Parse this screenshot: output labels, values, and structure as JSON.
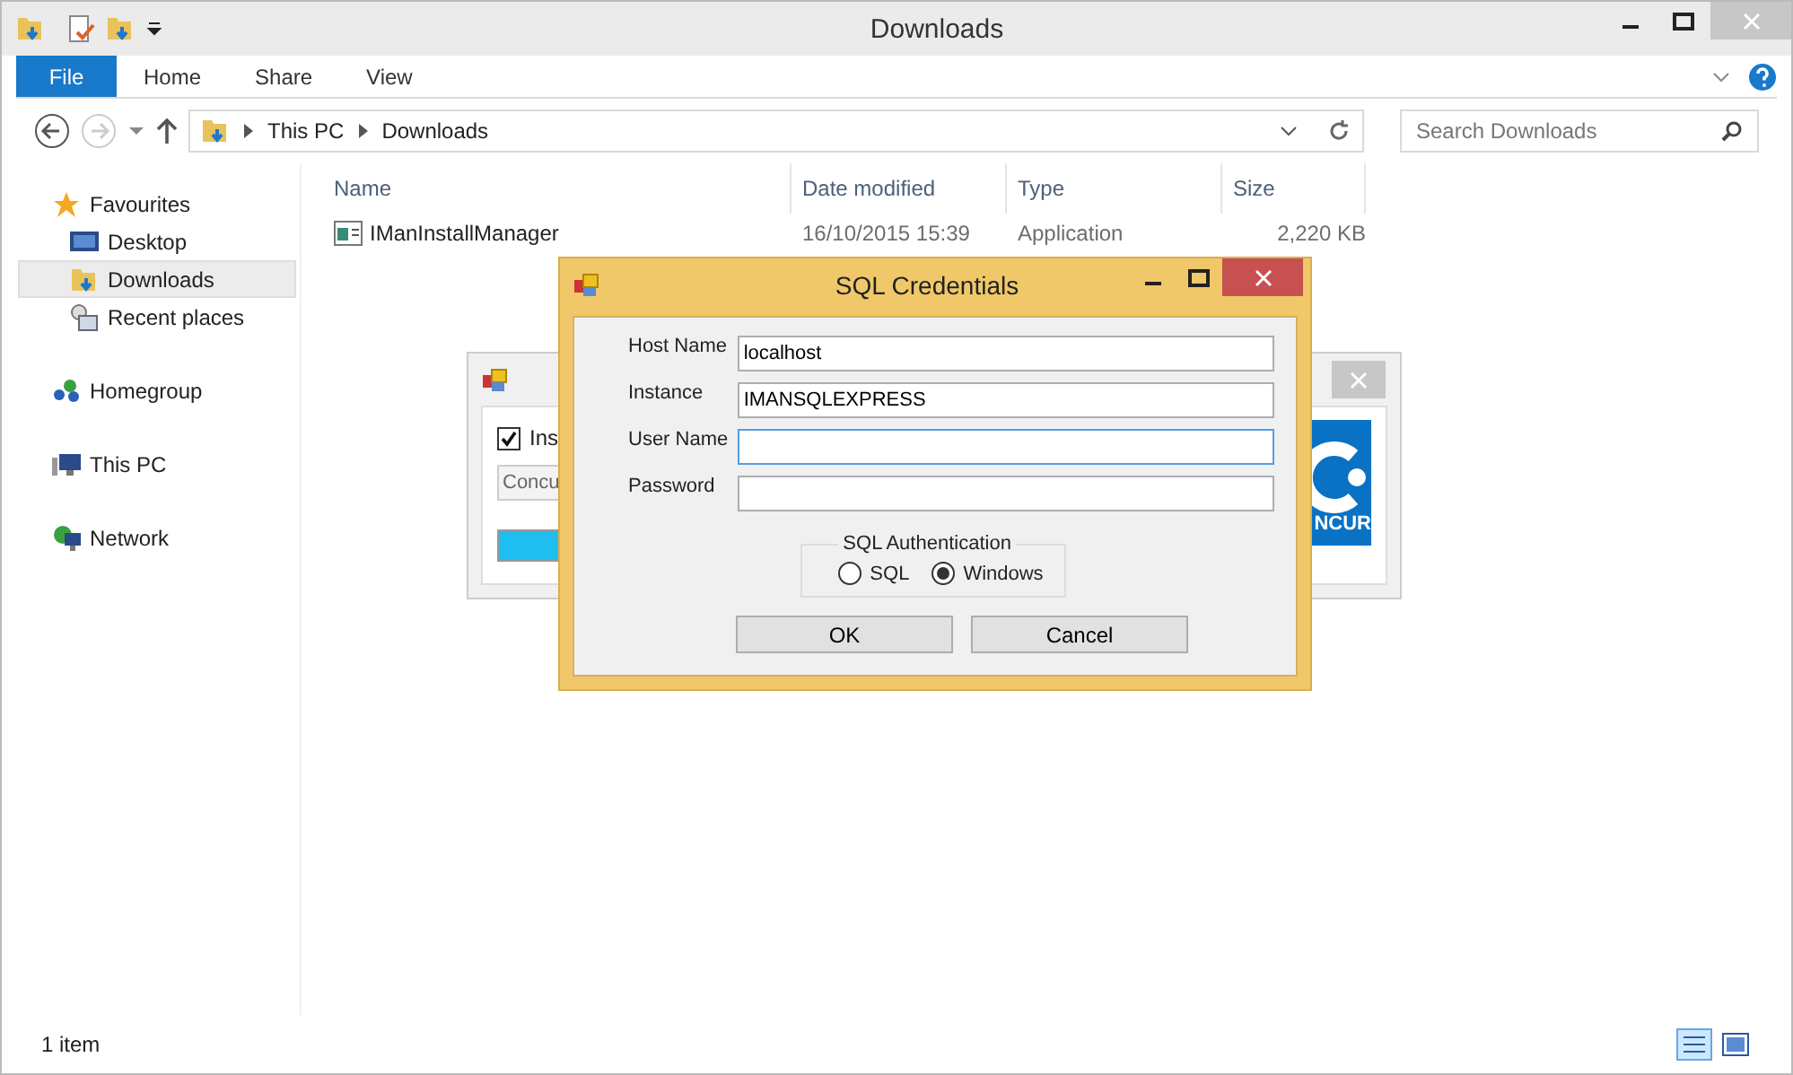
{
  "window": {
    "title": "Downloads"
  },
  "ribbon_tabs": [
    {
      "label": "File",
      "selected": true
    },
    {
      "label": "Home",
      "selected": false
    },
    {
      "label": "Share",
      "selected": false
    },
    {
      "label": "View",
      "selected": false
    }
  ],
  "breadcrumb": [
    "This PC",
    "Downloads"
  ],
  "search": {
    "placeholder": "Search Downloads"
  },
  "sidebar": {
    "groups": [
      {
        "label": "Favourites",
        "selected": false,
        "children": [
          {
            "label": "Desktop",
            "selected": false
          },
          {
            "label": "Downloads",
            "selected": true
          },
          {
            "label": "Recent places",
            "selected": false
          }
        ]
      },
      {
        "label": "Homegroup",
        "selected": false
      },
      {
        "label": "This PC",
        "selected": false
      },
      {
        "label": "Network",
        "selected": false
      }
    ]
  },
  "table": {
    "columns": [
      "Name",
      "Date modified",
      "Type",
      "Size"
    ],
    "rows": [
      {
        "name": "IManInstallManager",
        "date": "16/10/2015 15:39",
        "type": "Application",
        "size": "2,220 KB"
      }
    ]
  },
  "status_bar": {
    "count": "1 item"
  },
  "background_dialog": {
    "checkbox": {
      "label": "Ins",
      "checked": true
    },
    "combo_text": "Concu",
    "logo_text": "NCUR"
  },
  "dialog": {
    "title": "SQL Credentials",
    "fields": [
      {
        "label": "Host Name",
        "value": "localhost",
        "focused": false
      },
      {
        "label": "Instance",
        "value": "IMANSQLEXPRESS",
        "focused": false
      },
      {
        "label": "User Name",
        "focused": true
      },
      {
        "label": "Password",
        "focused": false
      }
    ],
    "auth": {
      "legend": "SQL Authentication",
      "options": [
        {
          "label": "SQL",
          "selected": false
        },
        {
          "label": "Windows",
          "selected": true
        }
      ]
    },
    "buttons": [
      "OK",
      "Cancel"
    ]
  }
}
